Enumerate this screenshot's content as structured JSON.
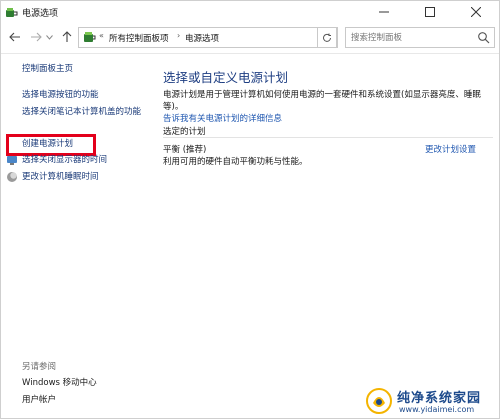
{
  "window": {
    "title": "电源选项"
  },
  "nav": {
    "breadcrumbs": [
      "所有控制面板项",
      "电源选项"
    ],
    "search_placeholder": "搜索控制面板"
  },
  "left_pane": {
    "home_link": "控制面板主页",
    "links": [
      "选择电源按钮的功能",
      "选择关闭笔记本计算机盖的功能",
      "创建电源计划"
    ],
    "icon_links": [
      "选择关闭显示器的时间",
      "更改计算机睡眠时间"
    ],
    "see_also_label": "另请参阅",
    "see_also_links": [
      "Windows 移动中心",
      "用户帐户"
    ],
    "highlight_color": "#e3001b"
  },
  "main": {
    "title": "选择或自定义电源计划",
    "description": "电源计划是用于管理计算机如何使用电源的一套硬件和系统设置(如显示器亮度、睡眠等)。",
    "description_link": "告诉我有关电源计划的详细信息",
    "selected_plans_label": "选定的计划",
    "plan": {
      "name": "平衡 (推荐)",
      "description": "利用可用的硬件自动平衡功耗与性能。",
      "change_link": "更改计划设置"
    },
    "title_color": "#1e3e82",
    "link_color": "#1f57b0"
  },
  "watermark": {
    "name": "纯净系统家园",
    "url": "www.yidaimei.com"
  }
}
